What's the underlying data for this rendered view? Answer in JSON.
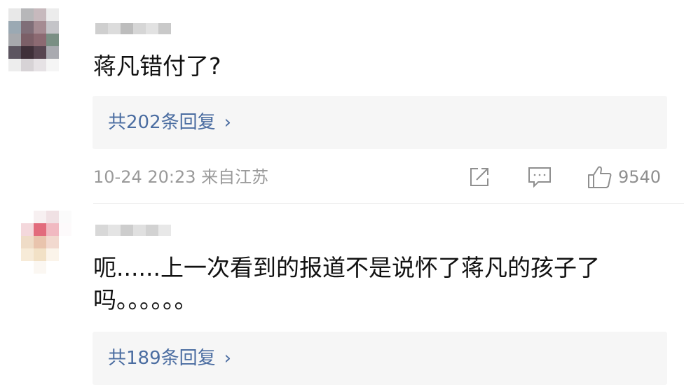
{
  "comments": [
    {
      "text": "蒋凡错付了?",
      "reply_label": "共202条回复",
      "chevron": "›",
      "meta": "10-24 20:23 来自江苏",
      "likes": "9540",
      "avatar_colors": [
        [
          "#e8e8e8",
          "#b7b7b9",
          "#c7b9bd",
          "#ececec"
        ],
        [
          "#9ba9b3",
          "#7f6e78",
          "#a58b92",
          "#c4c4c8"
        ],
        [
          "#a7a9ad",
          "#7b5f67",
          "#8c6a72",
          "#7a8f84"
        ],
        [
          "#5c5560",
          "#3f3039",
          "#574550",
          "#a9aab0"
        ],
        [
          "#ededed",
          "#d7d3d6",
          "#e6e2e5",
          "#f5f5f5"
        ]
      ],
      "name_colors": [
        "#cfcfcf",
        "#dcdcdc",
        "#bdbdbd",
        "#d6d6d6",
        "#e2e2e2",
        "#c9c9c9"
      ]
    },
    {
      "text": "呃......上一次看到的报道不是说怀了蒋凡的孩子了吗。。。。。。",
      "reply_label": "共189条回复",
      "chevron": "›",
      "avatar_colors": [
        [
          "#ffffff",
          "#f7f0f1",
          "#f0e1e4",
          "#fbfbfb"
        ],
        [
          "#f4d8dc",
          "#e26b7c",
          "#f1b9c1",
          "#fdfafb"
        ],
        [
          "#efdcc7",
          "#e9c4ad",
          "#f2d9cf",
          "#ffffff"
        ],
        [
          "#f7ebd8",
          "#f2e1c6",
          "#fbf4ea",
          "#ffffff"
        ],
        [
          "#ffffff",
          "#fbf7f2",
          "#ffffff",
          "#ffffff"
        ]
      ],
      "name_colors": [
        "#d8d8d8",
        "#e4e4e4",
        "#cdcdcd",
        "#e0e0e0",
        "#d2d2d2",
        "#e8e8e8"
      ]
    }
  ],
  "icons": {
    "share": "share-icon",
    "comment": "comment-icon",
    "like": "thumbs-up-icon"
  },
  "colors": {
    "link": "#4b6da1",
    "meta": "#9a9a9a",
    "reply_bg": "#f6f6f6"
  }
}
